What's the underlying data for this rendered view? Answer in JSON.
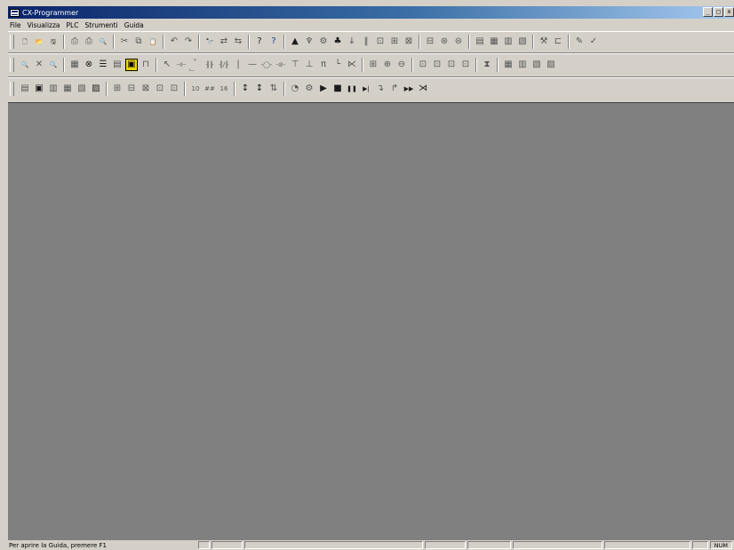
{
  "window": {
    "title": "CX-Programmer",
    "minimize_label": "_",
    "maximize_label": "□",
    "close_label": "x"
  },
  "menu": [
    {
      "label": "File"
    },
    {
      "label": "Visualizza"
    },
    {
      "label": "PLC"
    },
    {
      "label": "Strumenti"
    },
    {
      "label": "Guida"
    }
  ],
  "toolbar1": [
    {
      "name": "new-file-icon",
      "glyph": "🗋",
      "tone": "dark"
    },
    {
      "name": "open-folder-icon",
      "glyph": "📂",
      "tone": "yellow-i"
    },
    {
      "name": "save-icon",
      "glyph": "🖫",
      "tone": "dark"
    },
    {
      "sep": true
    },
    {
      "name": "print-setup-icon",
      "glyph": "⎙",
      "tone": "dim"
    },
    {
      "name": "print-icon",
      "glyph": "⎙",
      "tone": "dim"
    },
    {
      "name": "print-preview-icon",
      "glyph": "🔍",
      "tone": "dim"
    },
    {
      "sep": true
    },
    {
      "name": "cut-icon",
      "glyph": "✂",
      "tone": "dim"
    },
    {
      "name": "copy-icon",
      "glyph": "⧉",
      "tone": "dim"
    },
    {
      "name": "paste-icon",
      "glyph": "📋",
      "tone": "dark"
    },
    {
      "sep": true
    },
    {
      "name": "undo-icon",
      "glyph": "↶",
      "tone": "dim"
    },
    {
      "name": "redo-icon",
      "glyph": "↷",
      "tone": "dim"
    },
    {
      "sep": true
    },
    {
      "name": "find-icon",
      "glyph": "🔭",
      "tone": "dim"
    },
    {
      "name": "replace-icon",
      "glyph": "⇄",
      "tone": "dim"
    },
    {
      "name": "cross-reference-icon",
      "glyph": "⇆",
      "tone": "dim"
    },
    {
      "sep": true
    },
    {
      "name": "help-icon",
      "glyph": "?",
      "tone": "dark"
    },
    {
      "name": "context-help-icon",
      "glyph": "?",
      "tone": "blue"
    },
    {
      "sep": true
    },
    {
      "name": "work-online-icon",
      "glyph": "▲",
      "tone": "dark"
    },
    {
      "name": "monitor-icon",
      "glyph": "♆",
      "tone": "dim"
    },
    {
      "name": "compile-icon",
      "glyph": "⚙",
      "tone": "dim"
    },
    {
      "name": "transfer-icon",
      "glyph": "♣",
      "tone": "dark"
    },
    {
      "name": "download-icon",
      "glyph": "↓",
      "tone": "dim"
    },
    {
      "name": "pause-icon",
      "glyph": "‖",
      "tone": "dim"
    },
    {
      "name": "compare-icon",
      "glyph": "⊡",
      "tone": "dim"
    },
    {
      "name": "upload-icon",
      "glyph": "⊞",
      "tone": "dim"
    },
    {
      "name": "verify-icon",
      "glyph": "⊠",
      "tone": "dim"
    },
    {
      "sep": true
    },
    {
      "name": "plc-mode-program-icon",
      "glyph": "⊟",
      "tone": "dim"
    },
    {
      "name": "plc-mode-debug-icon",
      "glyph": "⊛",
      "tone": "dim"
    },
    {
      "name": "plc-mode-monitor-icon",
      "glyph": "⊜",
      "tone": "dim"
    },
    {
      "sep": true
    },
    {
      "name": "memory-icon",
      "glyph": "▤",
      "tone": "dim"
    },
    {
      "name": "io-table-icon",
      "glyph": "▦",
      "tone": "dim"
    },
    {
      "name": "settings-icon",
      "glyph": "▥",
      "tone": "dim"
    },
    {
      "name": "error-log-icon",
      "glyph": "▧",
      "tone": "dim"
    },
    {
      "sep": true
    },
    {
      "name": "force-on-icon",
      "glyph": "⚒",
      "tone": "dim"
    },
    {
      "name": "force-off-icon",
      "glyph": "⊏",
      "tone": "dim"
    },
    {
      "sep": true
    },
    {
      "name": "edit-online-icon",
      "glyph": "✎",
      "tone": "dim"
    },
    {
      "name": "apply-edit-icon",
      "glyph": "✓",
      "tone": "dim"
    }
  ],
  "toolbar2": [
    {
      "name": "zoom-in-icon",
      "glyph": "🔍",
      "tone": "dim"
    },
    {
      "name": "zoom-out-icon",
      "glyph": "✕",
      "tone": "dim"
    },
    {
      "name": "zoom-fit-icon",
      "glyph": "🔍",
      "tone": "dim"
    },
    {
      "sep": true
    },
    {
      "name": "grid-icon",
      "glyph": "▦",
      "tone": "dim"
    },
    {
      "name": "comments-icon",
      "glyph": "⊗",
      "tone": "dark"
    },
    {
      "name": "list-view-icon",
      "glyph": "☰",
      "tone": "dark"
    },
    {
      "name": "mnemonic-view-icon",
      "glyph": "▤",
      "tone": "dim"
    },
    {
      "name": "ladder-view-icon",
      "glyph": "▣",
      "tone": "yellow"
    },
    {
      "name": "symbol-table-icon",
      "glyph": "⊓",
      "tone": "dim"
    },
    {
      "sep": true
    },
    {
      "name": "select-mode-icon",
      "glyph": "↖",
      "tone": "dim"
    },
    {
      "name": "contact-no-icon",
      "glyph": "⊣⊢",
      "tone": "dim"
    },
    {
      "name": "contact-nc-icon",
      "glyph": "⊣/⊢",
      "tone": "dim"
    },
    {
      "name": "contact-or-no-icon",
      "glyph": "╢╟",
      "tone": "dim"
    },
    {
      "name": "contact-or-nc-icon",
      "glyph": "╢/╟",
      "tone": "dim"
    },
    {
      "name": "vertical-line-icon",
      "glyph": "|",
      "tone": "dim"
    },
    {
      "name": "horizontal-line-icon",
      "glyph": "—",
      "tone": "dim"
    },
    {
      "name": "coil-icon",
      "glyph": "-◯-",
      "tone": "dim"
    },
    {
      "name": "coil-nc-icon",
      "glyph": "-⊘-",
      "tone": "dim"
    },
    {
      "name": "instruction-icon",
      "glyph": "⊤",
      "tone": "dim"
    },
    {
      "name": "instruction-2-icon",
      "glyph": "⊥",
      "tone": "dim"
    },
    {
      "name": "instruction-3-icon",
      "glyph": "π",
      "tone": "dim"
    },
    {
      "name": "line-connect-icon",
      "glyph": "└",
      "tone": "dim"
    },
    {
      "name": "line-delete-icon",
      "glyph": "⋉",
      "tone": "dim"
    },
    {
      "sep": true
    },
    {
      "name": "watch-window-icon",
      "glyph": "⊞",
      "tone": "dim"
    },
    {
      "name": "watch-add-icon",
      "glyph": "⊕",
      "tone": "dim"
    },
    {
      "name": "watch-remove-icon",
      "glyph": "⊖",
      "tone": "dim"
    },
    {
      "sep": true
    },
    {
      "name": "online-edit-start-icon",
      "glyph": "⊡",
      "tone": "dim"
    },
    {
      "name": "online-edit-send-icon",
      "glyph": "⊡",
      "tone": "dim"
    },
    {
      "name": "online-edit-cancel-icon",
      "glyph": "⊡",
      "tone": "dim"
    },
    {
      "name": "online-edit-end-icon",
      "glyph": "⊡",
      "tone": "dim"
    },
    {
      "sep": true
    },
    {
      "name": "timer-icon",
      "glyph": "⧗",
      "tone": "dim"
    },
    {
      "sep": true
    },
    {
      "name": "trace-icon",
      "glyph": "▦",
      "tone": "dim"
    },
    {
      "name": "trace-2-icon",
      "glyph": "▥",
      "tone": "dim"
    },
    {
      "name": "trace-3-icon",
      "glyph": "▧",
      "tone": "dim"
    },
    {
      "name": "trace-4-icon",
      "glyph": "▨",
      "tone": "dim"
    }
  ],
  "toolbar3": [
    {
      "name": "project-window-icon",
      "glyph": "▤",
      "tone": "dim"
    },
    {
      "name": "output-window-icon",
      "glyph": "▣",
      "tone": "dark"
    },
    {
      "name": "watch-view-icon",
      "glyph": "▥",
      "tone": "dim"
    },
    {
      "name": "address-ref-icon",
      "glyph": "▦",
      "tone": "dim"
    },
    {
      "name": "properties-icon",
      "glyph": "▧",
      "tone": "dim"
    },
    {
      "name": "io-comment-icon",
      "glyph": "▨",
      "tone": "dark"
    },
    {
      "sep": true
    },
    {
      "name": "sfc-icon",
      "glyph": "⊞",
      "tone": "dim"
    },
    {
      "name": "st-icon",
      "glyph": "⊟",
      "tone": "dim"
    },
    {
      "name": "function-block-icon",
      "glyph": "⊠",
      "tone": "dim"
    },
    {
      "name": "section-icon",
      "glyph": "⊡",
      "tone": "dim"
    },
    {
      "name": "task-icon",
      "glyph": "⊡",
      "tone": "dim"
    },
    {
      "sep": true
    },
    {
      "name": "decimal-display-icon",
      "glyph": "10",
      "tone": "dim"
    },
    {
      "name": "binary-display-icon",
      "glyph": "##",
      "tone": "dim"
    },
    {
      "name": "hex-display-icon",
      "glyph": "16",
      "tone": "dim"
    },
    {
      "sep": true
    },
    {
      "name": "set-value-icon",
      "glyph": "↕",
      "tone": "dark"
    },
    {
      "name": "change-value-icon",
      "glyph": "↕",
      "tone": "dark"
    },
    {
      "name": "differential-monitor-icon",
      "glyph": "⇅",
      "tone": "dim"
    },
    {
      "sep": true
    },
    {
      "name": "simulator-icon",
      "glyph": "◔",
      "tone": "dim"
    },
    {
      "name": "simulator-settings-icon",
      "glyph": "⚙",
      "tone": "dim"
    },
    {
      "name": "run-icon",
      "glyph": "▶",
      "tone": "dark"
    },
    {
      "name": "stop-icon",
      "glyph": "■",
      "tone": "dark"
    },
    {
      "name": "pause-sim-icon",
      "glyph": "❚❚",
      "tone": "dark"
    },
    {
      "name": "step-icon",
      "glyph": "▶|",
      "tone": "dark"
    },
    {
      "name": "step-in-icon",
      "glyph": "↴",
      "tone": "dim"
    },
    {
      "name": "step-out-icon",
      "glyph": "↱",
      "tone": "dim"
    },
    {
      "name": "continuous-step-icon",
      "glyph": "▶▶",
      "tone": "dark"
    },
    {
      "name": "scan-run-icon",
      "glyph": "⋊",
      "tone": "dark"
    }
  ],
  "status": {
    "message": "Per aprire la Guida, premere F1",
    "num_indicator": "NUM"
  }
}
